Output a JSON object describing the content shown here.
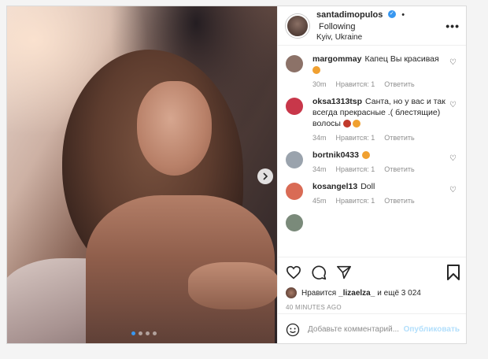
{
  "header": {
    "username": "santadimopulos",
    "verified_glyph": "✓",
    "separator": "•",
    "follow_label": "Following",
    "location": "Kyiv, Ukraine",
    "more_icon": "more-horizontal-icon"
  },
  "carousel": {
    "next_icon": "chevron-right-icon",
    "dots_count": 4,
    "active_dot": 1
  },
  "comments": [
    {
      "user": "margommay",
      "text": "Капец Вы красивая",
      "time": "30m",
      "likes": "Нравится: 1",
      "reply": "Ответить",
      "avatar_color": "#8c7268"
    },
    {
      "user": "oksa1313tsp",
      "text": "Санта, но у вас и так всегда прекрасные .( блестящие) волосы",
      "time": "34m",
      "likes": "Нравится: 1",
      "reply": "Ответить",
      "avatar_color": "#c8374a"
    },
    {
      "user": "bortnik0433",
      "text": "",
      "time": "34m",
      "likes": "Нравится: 1",
      "reply": "Ответить",
      "avatar_color": "#9aa3ad"
    },
    {
      "user": "kosangel13",
      "text": "Doll",
      "time": "45m",
      "likes": "Нравится: 1",
      "reply": "Ответить",
      "avatar_color": "#d96b55"
    }
  ],
  "actions": {
    "like_icon": "heart-icon",
    "comment_icon": "comment-icon",
    "share_icon": "send-icon",
    "save_icon": "bookmark-icon"
  },
  "likes": {
    "prefix": "Нравится",
    "user": "_lizaelza_",
    "suffix": "и ещё 3 024"
  },
  "timestamp": "40 MINUTES AGO",
  "add_comment": {
    "emoji_icon": "smile-icon",
    "placeholder": "Добавьте комментарий...",
    "post_label": "Опубликовать"
  },
  "colors": {
    "accent": "#3897f0",
    "post_disabled": "#b2dffc",
    "muted": "#8e8e8e"
  }
}
